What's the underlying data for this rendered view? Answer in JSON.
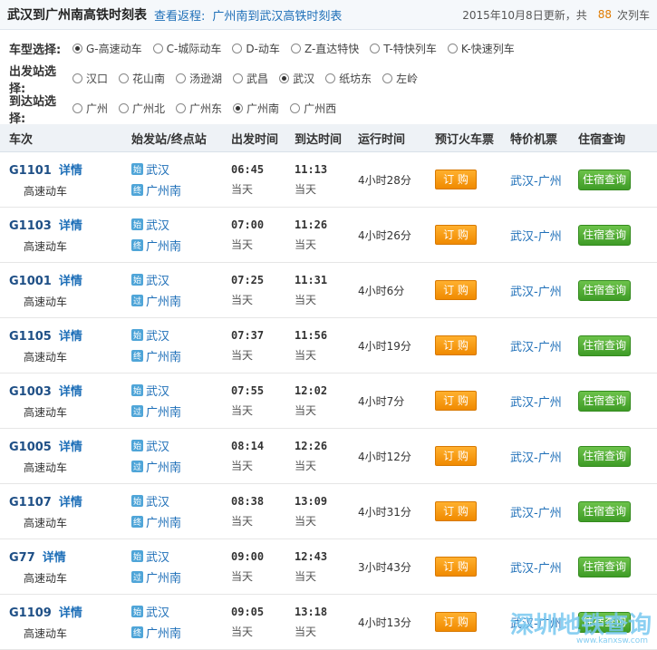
{
  "header": {
    "title": "武汉到广州南高铁时刻表",
    "return_link": "查看返程:",
    "return_title": "广州南到武汉高铁时刻表",
    "updated": "2015年10月8日更新，共",
    "count": "88",
    "count_unit": "次列车"
  },
  "filters": {
    "type": {
      "label": "车型选择:",
      "options": [
        {
          "label": "G-高速动车",
          "checked": true
        },
        {
          "label": "C-城际动车",
          "checked": false
        },
        {
          "label": "D-动车",
          "checked": false
        },
        {
          "label": "Z-直达特快",
          "checked": false
        },
        {
          "label": "T-特快列车",
          "checked": false
        },
        {
          "label": "K-快速列车",
          "checked": false
        }
      ]
    },
    "depart": {
      "label": "出发站选择:",
      "options": [
        {
          "label": "汉口",
          "checked": false
        },
        {
          "label": "花山南",
          "checked": false
        },
        {
          "label": "汤逊湖",
          "checked": false
        },
        {
          "label": "武昌",
          "checked": false
        },
        {
          "label": "武汉",
          "checked": true
        },
        {
          "label": "纸坊东",
          "checked": false
        },
        {
          "label": "左岭",
          "checked": false
        }
      ]
    },
    "arrive": {
      "label": "到达站选择:",
      "options": [
        {
          "label": "广州",
          "checked": false
        },
        {
          "label": "广州北",
          "checked": false
        },
        {
          "label": "广州东",
          "checked": false
        },
        {
          "label": "广州南",
          "checked": true
        },
        {
          "label": "广州西",
          "checked": false
        }
      ]
    }
  },
  "table": {
    "headers": {
      "train": "车次",
      "station": "始发站/终点站",
      "depart": "出发时间",
      "arrive": "到达时间",
      "duration": "运行时间",
      "book": "预订火车票",
      "fare": "特价机票",
      "hotel": "住宿查询"
    },
    "detail_label": "详情",
    "book_label": "订 购",
    "hotel_label": "住宿查询",
    "same_day": "当天",
    "rows": [
      {
        "no": "G1101",
        "type": "高速动车",
        "from": "武汉",
        "from_badge": "始",
        "to": "广州南",
        "to_badge": "终",
        "dep": "06:45",
        "arr": "11:13",
        "dur": "4小时28分",
        "fare": "武汉-广州"
      },
      {
        "no": "G1103",
        "type": "高速动车",
        "from": "武汉",
        "from_badge": "始",
        "to": "广州南",
        "to_badge": "终",
        "dep": "07:00",
        "arr": "11:26",
        "dur": "4小时26分",
        "fare": "武汉-广州"
      },
      {
        "no": "G1001",
        "type": "高速动车",
        "from": "武汉",
        "from_badge": "始",
        "to": "广州南",
        "to_badge": "过",
        "dep": "07:25",
        "arr": "11:31",
        "dur": "4小时6分",
        "fare": "武汉-广州"
      },
      {
        "no": "G1105",
        "type": "高速动车",
        "from": "武汉",
        "from_badge": "始",
        "to": "广州南",
        "to_badge": "终",
        "dep": "07:37",
        "arr": "11:56",
        "dur": "4小时19分",
        "fare": "武汉-广州"
      },
      {
        "no": "G1003",
        "type": "高速动车",
        "from": "武汉",
        "from_badge": "始",
        "to": "广州南",
        "to_badge": "过",
        "dep": "07:55",
        "arr": "12:02",
        "dur": "4小时7分",
        "fare": "武汉-广州"
      },
      {
        "no": "G1005",
        "type": "高速动车",
        "from": "武汉",
        "from_badge": "始",
        "to": "广州南",
        "to_badge": "过",
        "dep": "08:14",
        "arr": "12:26",
        "dur": "4小时12分",
        "fare": "武汉-广州"
      },
      {
        "no": "G1107",
        "type": "高速动车",
        "from": "武汉",
        "from_badge": "始",
        "to": "广州南",
        "to_badge": "终",
        "dep": "08:38",
        "arr": "13:09",
        "dur": "4小时31分",
        "fare": "武汉-广州"
      },
      {
        "no": "G77",
        "type": "高速动车",
        "from": "武汉",
        "from_badge": "始",
        "to": "广州南",
        "to_badge": "过",
        "dep": "09:00",
        "arr": "12:43",
        "dur": "3小时43分",
        "fare": "武汉-广州"
      },
      {
        "no": "G1109",
        "type": "高速动车",
        "from": "武汉",
        "from_badge": "始",
        "to": "广州南",
        "to_badge": "终",
        "dep": "09:05",
        "arr": "13:18",
        "dur": "4小时13分",
        "fare": "武汉-广州"
      }
    ]
  },
  "watermark": {
    "text": "深圳地铁查询",
    "url": "www.kanxsw.com"
  }
}
